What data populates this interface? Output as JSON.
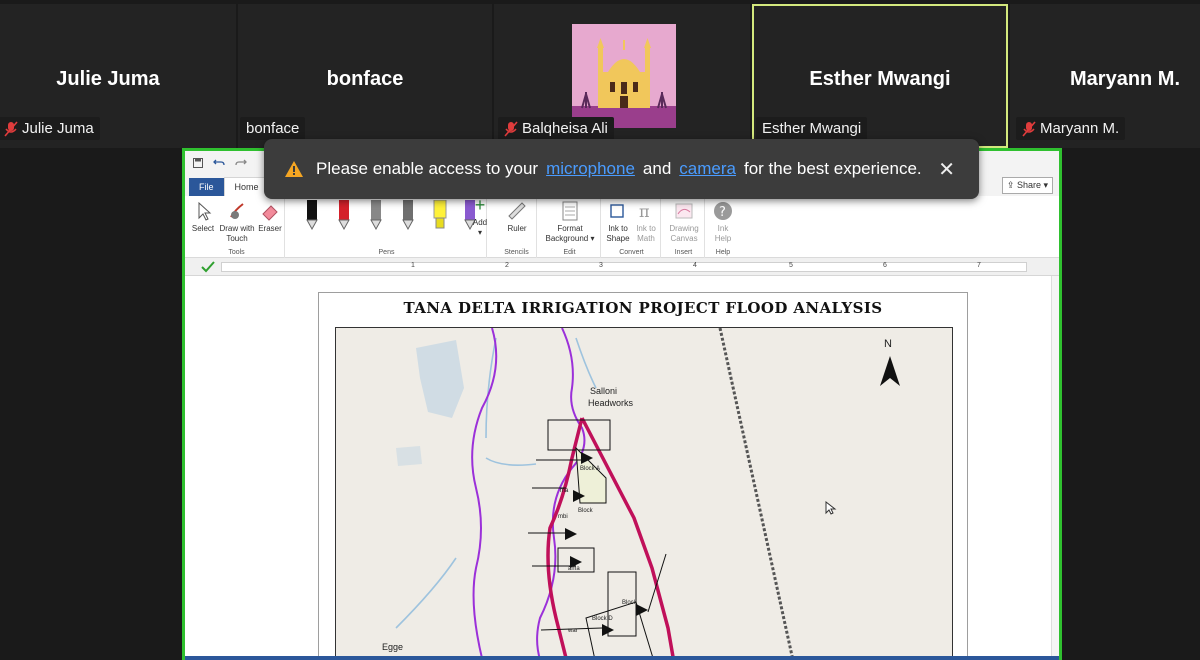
{
  "participants": [
    {
      "big_name": "Julie Juma",
      "tag": "Julie Juma",
      "muted": true
    },
    {
      "big_name": "bonface",
      "tag": "bonface",
      "muted": false
    },
    {
      "big_name": "",
      "tag": "Balqheisa Ali",
      "muted": true
    },
    {
      "big_name": "Esther Mwangi",
      "tag": "Esther Mwangi",
      "muted": false
    },
    {
      "big_name": "Maryann M.",
      "tag": "Maryann M.",
      "muted": true
    }
  ],
  "toast": {
    "pre": "Please enable access to your",
    "link1": "microphone",
    "mid": "and",
    "link2": "camera",
    "post": "for the best experience.",
    "close": "✕"
  },
  "word": {
    "tabs": {
      "file": "File",
      "home": "Home"
    },
    "share_label": "Share",
    "ribbon": {
      "select": "Select",
      "draw_with": "Draw with",
      "touch": "Touch",
      "eraser": "Eraser",
      "tools": "Tools",
      "pens": "Pens",
      "add": "Add",
      "ruler": "Ruler",
      "stencils": "Stencils",
      "format": "Format",
      "background": "Background",
      "edit": "Edit",
      "ink_to": "Ink to",
      "shape": "Shape",
      "ink_to2": "Ink to",
      "math": "Math",
      "convert": "Convert",
      "drawing": "Drawing",
      "canvas": "Canvas",
      "insert": "Insert",
      "ink": "Ink",
      "help_label": "Help",
      "help_group": "Help"
    },
    "ruler_numbers": [
      "1",
      "2",
      "3",
      "4",
      "5",
      "6",
      "7"
    ]
  },
  "map": {
    "title": "TANA DELTA IRRIGATION PROJECT FLOOD ANALYSIS",
    "north": "N",
    "labels": {
      "salloni": "Salloni",
      "headworks": "Headworks",
      "block_a": "Block A",
      "block_b": "Block",
      "ma": "ma",
      "mbi": "mbi",
      "ama": "ama",
      "block_c": "Block",
      "block_d": "Block D",
      "war": "war",
      "egge": "Egge"
    }
  },
  "colors": {
    "accent_border": "#2fc02f",
    "active_speaker": "#d3e87d",
    "river": "#9b30d9",
    "canal": "#c0105a",
    "link": "#4a9cff"
  }
}
